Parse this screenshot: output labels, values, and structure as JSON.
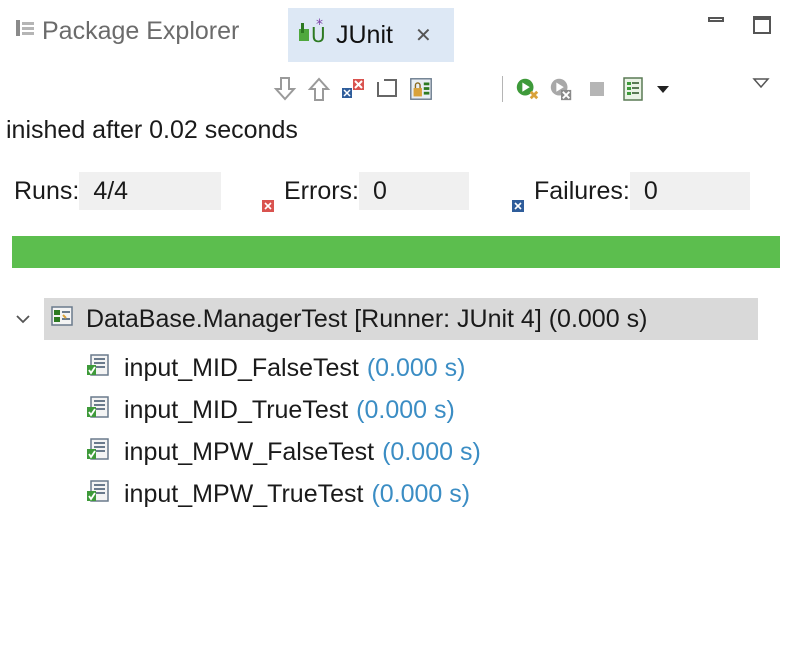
{
  "tabs": [
    {
      "label": "Package Explorer",
      "icon": "package-explorer-icon",
      "active": false
    },
    {
      "label": "JUnit",
      "icon": "junit-icon",
      "active": true,
      "close": "✕"
    }
  ],
  "toolbar": {
    "buttons": [
      "next-failure-icon",
      "previous-failure-icon",
      "show-failures-only-icon",
      "show-skipped-icon",
      "scroll-lock-icon",
      "rerun-test-icon",
      "rerun-failures-first-icon",
      "stop-icon",
      "test-run-history-icon",
      "history-dropdown-icon",
      "view-menu-icon"
    ]
  },
  "status": {
    "text": "inished after 0.02 seconds"
  },
  "counters": {
    "runs_label": "Runs:",
    "runs_value": "4/4",
    "errors_label": "Errors:",
    "errors_value": "0",
    "failures_label": "Failures:",
    "failures_value": "0"
  },
  "progress": {
    "fraction": 1.0,
    "color": "#5cbe4e"
  },
  "tree": {
    "root": {
      "label": "DataBase.ManagerTest [Runner: JUnit 4] (0.000 s)",
      "expanded": true
    },
    "items": [
      {
        "name": "input_MID_FalseTest",
        "time": "(0.000 s)"
      },
      {
        "name": "input_MID_TrueTest",
        "time": "(0.000 s)"
      },
      {
        "name": "input_MPW_FalseTest",
        "time": "(0.000 s)"
      },
      {
        "name": "input_MPW_TrueTest",
        "time": "(0.000 s)"
      }
    ]
  },
  "colors": {
    "active_tab": "#dde8f5",
    "selection": "#d9d9d9",
    "time_text": "#3b8dc4",
    "error_red": "#d9534f",
    "failure_blue": "#2f5d9b"
  }
}
